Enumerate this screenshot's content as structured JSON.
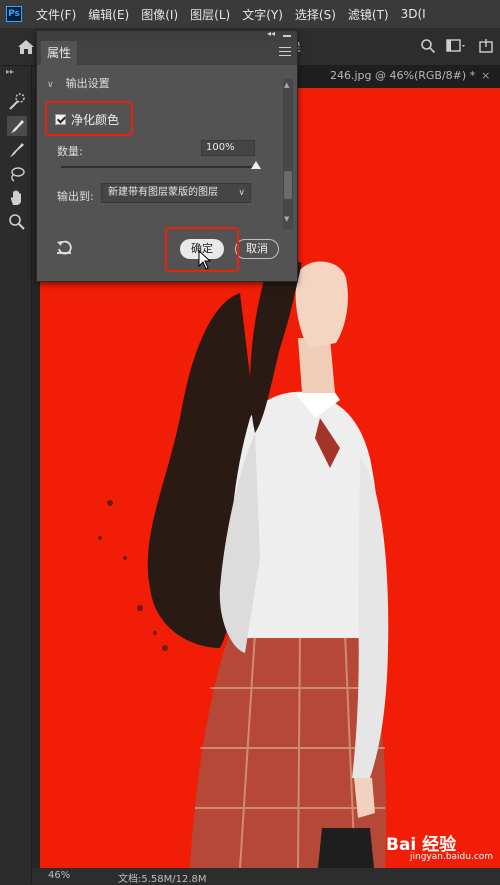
{
  "app": {
    "logo": "Ps"
  },
  "menu": [
    "文件(F)",
    "编辑(E)",
    "图像(I)",
    "图层(L)",
    "文字(Y)",
    "选择(S)",
    "滤镜(T)",
    "3D(I"
  ],
  "options_bar": {
    "partial_text": "咩"
  },
  "document_tab": {
    "title": "246.jpg @ 46%(RGB/8#) *",
    "close": "×"
  },
  "panel": {
    "tab_label": "属性",
    "section_title": "输出设置",
    "decontaminate": {
      "label": "净化颜色",
      "checked": true
    },
    "amount": {
      "label": "数量:",
      "value": "100%",
      "level": 1.0
    },
    "output_to": {
      "label": "输出到:",
      "selected": "新建带有图层蒙版的图层"
    },
    "ok_label": "确定",
    "cancel_label": "取消"
  },
  "status": {
    "zoom": "46%",
    "doc_size": "文档:5.58M/12.8M"
  },
  "watermark": {
    "text": "Bai 经验",
    "sub": "jingyan.baidu.com"
  },
  "colors": {
    "canvas_bg": "#f21d06",
    "highlight": "#e8220e"
  },
  "icons": [
    "home-icon",
    "search-icon",
    "workspace-icon",
    "share-icon",
    "quick-selection-icon",
    "refine-edge-brush-icon",
    "brush-icon",
    "lasso-icon",
    "hand-icon",
    "zoom-icon",
    "reset-icon",
    "cursor-icon"
  ]
}
